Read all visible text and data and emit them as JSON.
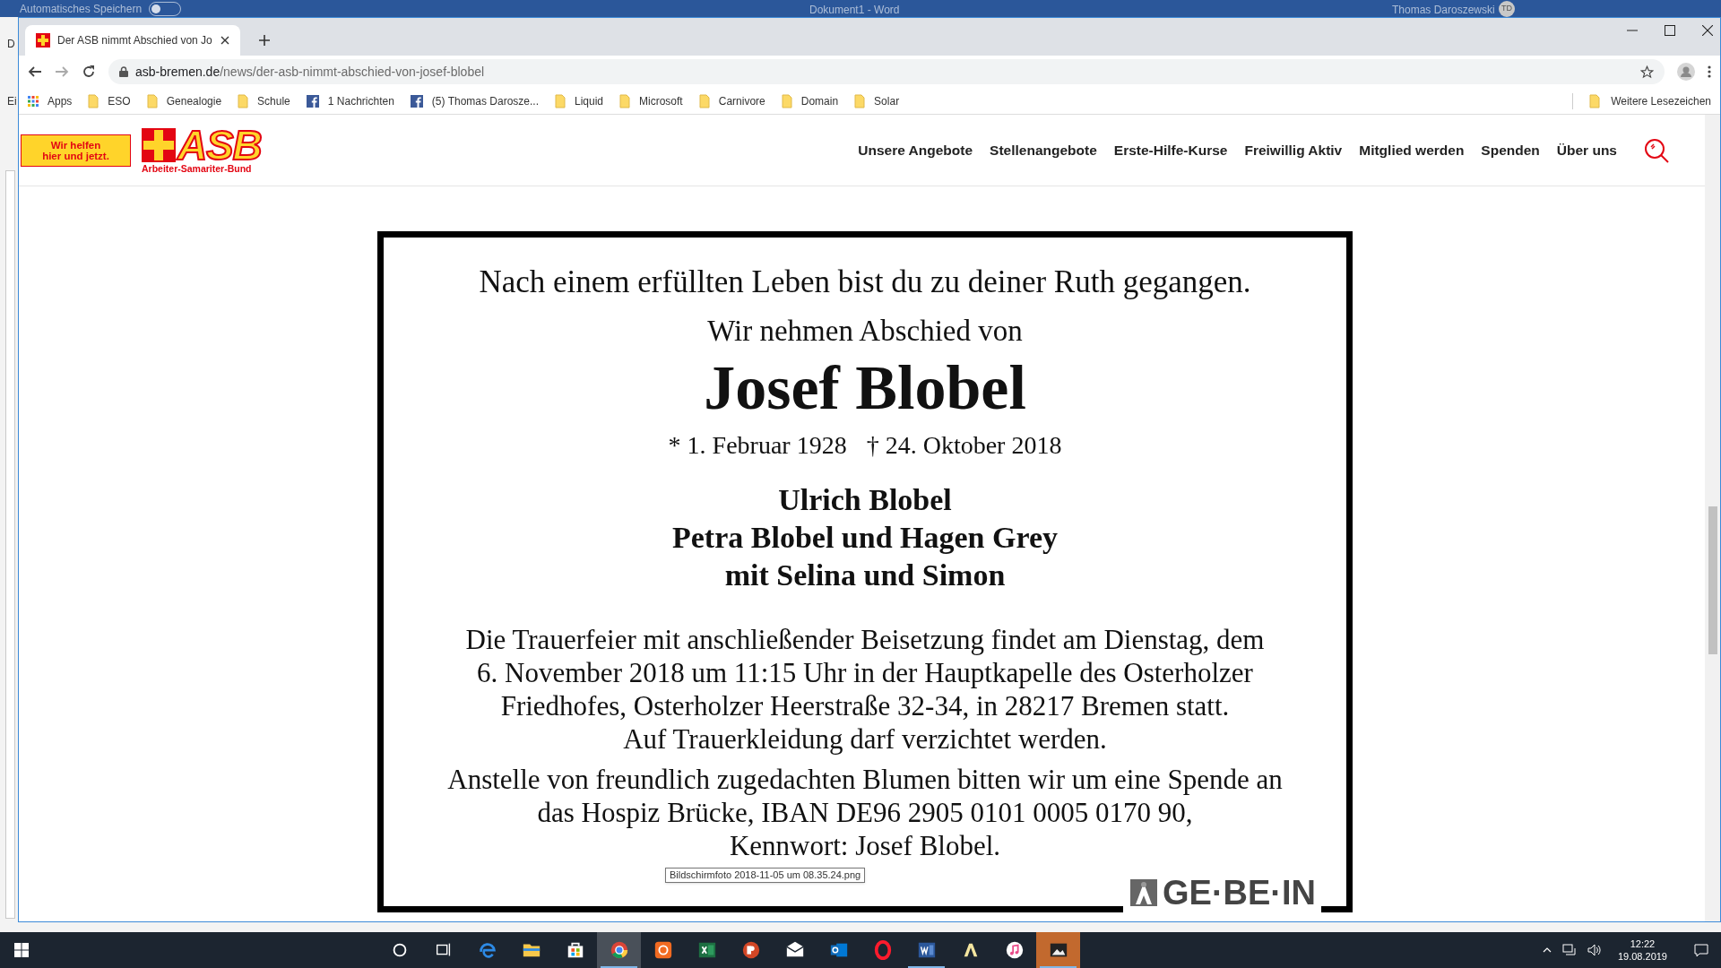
{
  "word_window": {
    "autosave_label": "Automatisches Speichern",
    "autosave_on": false,
    "title": "Dokument1  -  Word",
    "user": "Thomas Daroszewski",
    "user_initials": "TD",
    "ribbon_fragments": [
      "D",
      "Ei"
    ]
  },
  "browser": {
    "tabs": [
      {
        "title": "Der ASB nimmt Abschied von Jo",
        "selected": true
      }
    ],
    "url_host": "asb-bremen.de",
    "url_path": "/news/der-asb-nimmt-abschied-von-josef-blobel",
    "bookmarks": [
      {
        "kind": "apps",
        "label": "Apps"
      },
      {
        "kind": "folder",
        "label": "ESO"
      },
      {
        "kind": "folder",
        "label": "Genealogie"
      },
      {
        "kind": "folder",
        "label": "Schule"
      },
      {
        "kind": "facebook",
        "label": "1 Nachrichten"
      },
      {
        "kind": "facebook",
        "label": "(5) Thomas Darosze..."
      },
      {
        "kind": "folder",
        "label": "Liquid"
      },
      {
        "kind": "folder",
        "label": "Microsoft"
      },
      {
        "kind": "folder",
        "label": "Carnivore"
      },
      {
        "kind": "folder",
        "label": "Domain"
      },
      {
        "kind": "folder",
        "label": "Solar"
      }
    ],
    "more_bookmarks": "Weitere Lesezeichen"
  },
  "site": {
    "slogan": [
      "Wir helfen",
      "hier und jetzt."
    ],
    "logo_text": "ASB",
    "logo_subtitle": "Arbeiter-Samariter-Bund",
    "nav": [
      "Unsere Angebote",
      "Stellenangebote",
      "Erste-Hilfe-Kurse",
      "Freiwillig Aktiv",
      "Mitglied werden",
      "Spenden",
      "Über uns"
    ]
  },
  "notice": {
    "intro": "Nach einem erfüllten Leben bist du zu deiner Ruth gegangen.",
    "lead": "Wir nehmen Abschied von",
    "name": "Josef Blobel",
    "born": "* 1. Februar 1928",
    "died": "† 24. Oktober 2018",
    "mourners": [
      "Ulrich Blobel",
      "Petra Blobel und Hagen Grey",
      "mit Selina und Simon"
    ],
    "paragraphs": [
      [
        "Die Trauerfeier mit anschließender Beisetzung findet am Dienstag, dem",
        "6. November 2018 um 11:15 Uhr in der Hauptkapelle des Osterholzer",
        "Friedhofes, Osterholzer Heerstraße 32-34, in 28217 Bremen statt.",
        "Auf Trauerkleidung darf verzichtet werden."
      ],
      [
        "Anstelle von freundlich zugedachten Blumen bitten wir um eine Spende an",
        "das Hospiz Brücke, IBAN DE96 2905 0101 0005 0170 90,",
        "Kennwort: Josef Blobel."
      ]
    ],
    "logo": "GE·BE·IN"
  },
  "tooltip": "Bildschirmfoto 2018-11-05 um 08.35.24.png",
  "taskbar": {
    "apps": [
      {
        "kind": "search",
        "selected": false,
        "running": false
      },
      {
        "kind": "taskview",
        "selected": false,
        "running": false
      },
      {
        "kind": "edge",
        "selected": false,
        "running": false
      },
      {
        "kind": "explorer",
        "selected": false,
        "running": false
      },
      {
        "kind": "store",
        "selected": false,
        "running": false
      },
      {
        "kind": "chrome",
        "selected": true,
        "running": true
      },
      {
        "kind": "orange",
        "selected": false,
        "running": false
      },
      {
        "kind": "excel",
        "selected": false,
        "running": false
      },
      {
        "kind": "powerpoint",
        "selected": false,
        "running": false
      },
      {
        "kind": "mail",
        "selected": false,
        "running": false
      },
      {
        "kind": "outlook",
        "selected": false,
        "running": false
      },
      {
        "kind": "opera",
        "selected": false,
        "running": false
      },
      {
        "kind": "word",
        "selected": false,
        "running": true
      },
      {
        "kind": "letter",
        "selected": false,
        "running": false
      },
      {
        "kind": "music",
        "selected": false,
        "running": false
      },
      {
        "kind": "photo",
        "selected": true,
        "running": true
      }
    ],
    "time": "12:22",
    "date": "19.08.2019"
  }
}
